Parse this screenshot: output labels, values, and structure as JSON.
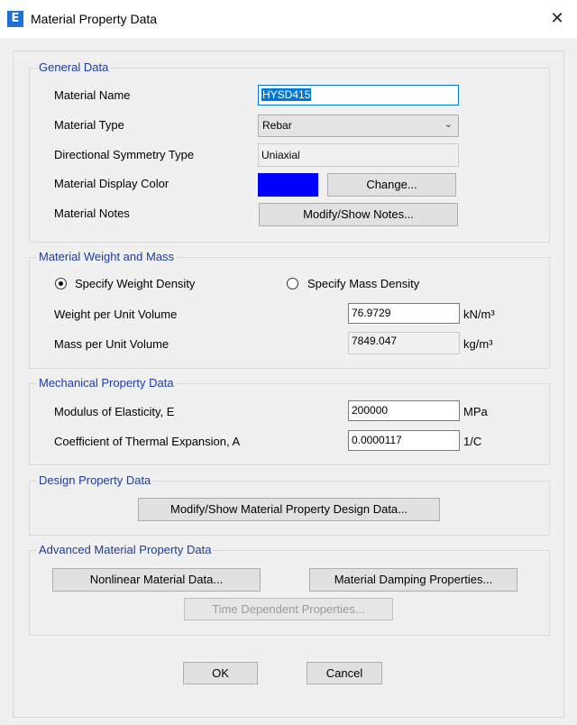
{
  "window": {
    "title": "Material Property Data",
    "app_icon_letter": "E",
    "close_glyph": "✕"
  },
  "general": {
    "legend": "General Data",
    "name_label": "Material Name",
    "name_value": "HYSD415",
    "type_label": "Material Type",
    "type_value": "Rebar",
    "symmetry_label": "Directional Symmetry Type",
    "symmetry_value": "Uniaxial",
    "color_label": "Material Display Color",
    "color_value": "#0000ff",
    "change_button": "Change...",
    "notes_label": "Material Notes",
    "notes_button": "Modify/Show Notes..."
  },
  "weight": {
    "legend": "Material Weight and Mass",
    "radio_weight": "Specify Weight Density",
    "radio_mass": "Specify Mass Density",
    "selected": "weight",
    "wpuv_label": "Weight per Unit Volume",
    "wpuv_value": "76.9729",
    "wpuv_unit": "kN/m³",
    "mpuv_label": "Mass per Unit Volume",
    "mpuv_value": "7849.047",
    "mpuv_unit": "kg/m³"
  },
  "mechanical": {
    "legend": "Mechanical Property Data",
    "e_label": "Modulus of Elasticity,  E",
    "e_value": "200000",
    "e_unit": "MPa",
    "a_label": "Coefficient of Thermal Expansion,  A",
    "a_value": "0.0000117",
    "a_unit": "1/C"
  },
  "design": {
    "legend": "Design Property Data",
    "button": "Modify/Show Material Property Design Data..."
  },
  "advanced": {
    "legend": "Advanced Material Property Data",
    "nonlinear_button": "Nonlinear Material Data...",
    "damping_button": "Material Damping Properties...",
    "time_button": "Time Dependent Properties..."
  },
  "footer": {
    "ok": "OK",
    "cancel": "Cancel"
  }
}
